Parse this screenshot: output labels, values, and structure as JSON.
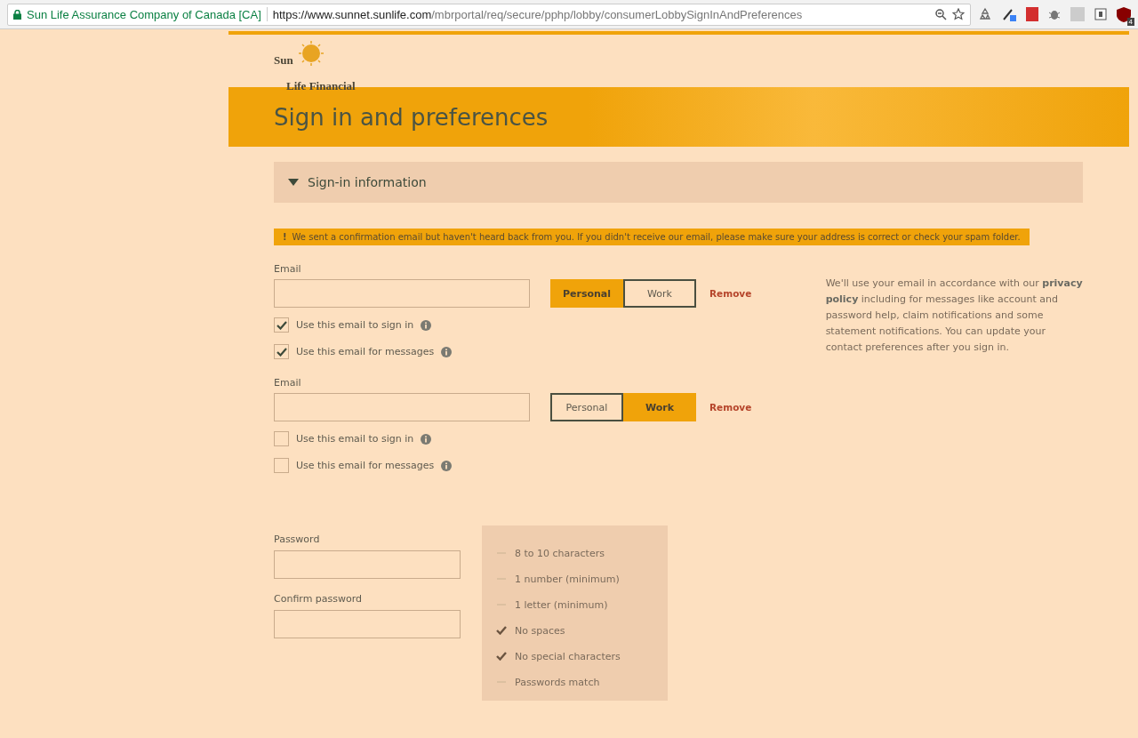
{
  "browser": {
    "site_name": "Sun Life Assurance Company of Canada [CA]",
    "url_host": "https://www.sunnet.sunlife.com",
    "url_path": "/mbrportal/req/secure/pphp/lobby/consumerLobbySignInAndPreferences",
    "extension_badge": "4"
  },
  "logo": {
    "line_1": "Sun",
    "line_2": "Life Financial"
  },
  "page_title": "Sign in and preferences",
  "section": {
    "title": "Sign-in information",
    "expanded": true
  },
  "warning": {
    "icon": "!",
    "text": "We sent a confirmation email but haven't heard back from you. If you didn't receive our email, please make sure your address is correct or check your spam folder."
  },
  "emails": [
    {
      "label": "Email",
      "types": [
        {
          "label": "Personal",
          "selected": true
        },
        {
          "label": "Work",
          "selected": false
        }
      ],
      "remove": "Remove",
      "options": [
        {
          "label": "Use this email to sign in",
          "checked": true
        },
        {
          "label": "Use this email for messages",
          "checked": true
        }
      ]
    },
    {
      "label": "Email",
      "types": [
        {
          "label": "Personal",
          "selected": false
        },
        {
          "label": "Work",
          "selected": true
        }
      ],
      "remove": "Remove",
      "options": [
        {
          "label": "Use this email to sign in",
          "checked": false
        },
        {
          "label": "Use this email for messages",
          "checked": false
        }
      ]
    }
  ],
  "email_note": "We'll use your email in accordance with our **privacy policy** including for messages like account and password help, claim notifications and some statement notifications. You can update your contact preferences after you sign in.",
  "password": {
    "label": "Password",
    "confirm_label": "Confirm password"
  },
  "requirements": [
    {
      "text": "8 to 10 characters",
      "met": false
    },
    {
      "text": "1 number (minimum)",
      "met": false
    },
    {
      "text": "1 letter (minimum)",
      "met": false
    },
    {
      "text": "No spaces",
      "met": true
    },
    {
      "text": "No special characters",
      "met": true
    },
    {
      "text": "Passwords match",
      "met": false
    }
  ]
}
